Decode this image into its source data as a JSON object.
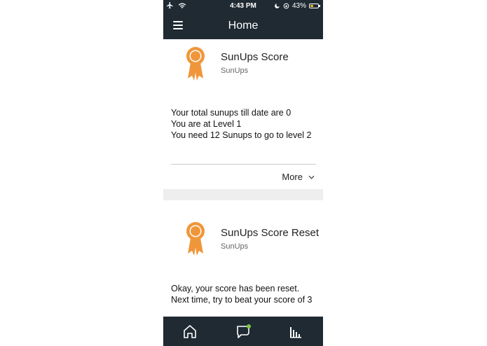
{
  "status_bar": {
    "time": "4:43 PM",
    "battery_percent": "43%",
    "battery_level": 0.43
  },
  "header": {
    "title": "Home",
    "menu_icon": "hamburger-menu-icon"
  },
  "cards": [
    {
      "icon": "award-ribbon-icon",
      "title": "SunUps Score",
      "subtitle": "SunUps",
      "lines": [
        "Your total sunups till date are 0",
        "You are at Level 1",
        "You need 12 Sunups to go to level 2"
      ],
      "more_label": "More"
    },
    {
      "icon": "award-ribbon-icon",
      "title": "SunUps Score Reset",
      "subtitle": "SunUps",
      "text": "Okay, your score has been reset. Next time, try to beat your score of 3"
    }
  ],
  "bottom_nav": [
    {
      "icon": "home-icon"
    },
    {
      "icon": "chat-bubble-icon"
    },
    {
      "icon": "activity-icon"
    }
  ],
  "colors": {
    "header_bg": "#1f2a33",
    "accent": "#f0963a",
    "notification_dot": "#7ac943"
  }
}
